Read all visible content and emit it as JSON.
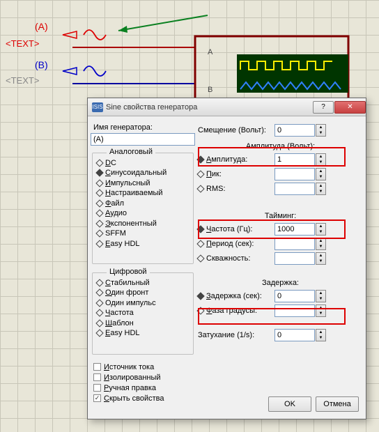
{
  "circuit": {
    "label_a": "(A)",
    "text_a": "<TEXT>",
    "label_b": "(B)",
    "text_b": "<TEXT>",
    "osc_a": "A",
    "osc_b": "B"
  },
  "dialog": {
    "title": "Sine свойства генератора",
    "name_label": "Имя генератора:",
    "name_value": "(A)",
    "analog_legend": "Аналоговый",
    "analog_items": [
      {
        "label": "DC",
        "u": "D"
      },
      {
        "label": "Синусоидальный",
        "u": "С",
        "selected": true
      },
      {
        "label": "Импульсный",
        "u": "И"
      },
      {
        "label": "Настраиваемый",
        "u": "Н"
      },
      {
        "label": "Файл",
        "u": "Ф"
      },
      {
        "label": "Аудио",
        "u": "А"
      },
      {
        "label": "Экспонентный",
        "u": "Э"
      },
      {
        "label": "SFFM"
      },
      {
        "label": "Easy HDL",
        "u": "E"
      }
    ],
    "digital_legend": "Цифровой",
    "digital_items": [
      {
        "label": "Стабильный",
        "u": "С"
      },
      {
        "label": "Один фронт",
        "u": "О"
      },
      {
        "label": "Один импульс"
      },
      {
        "label": "Частота",
        "u": "Ч"
      },
      {
        "label": "Шаблон",
        "u": "Ш"
      },
      {
        "label": "Easy HDL",
        "u": "E"
      }
    ],
    "checks": [
      {
        "label": "Источник тока",
        "u": "И"
      },
      {
        "label": "Изолированный",
        "u": "И"
      },
      {
        "label": "Ручная правка",
        "u": "Р"
      },
      {
        "label": "Скрыть свойства",
        "u": "С",
        "checked": true
      }
    ],
    "offset_label": "Смещение (Вольт):",
    "offset_value": "0",
    "amp_section": "Амплитуда (Вольт):",
    "amp_rows": [
      {
        "label": "Амплитуда:",
        "value": "1",
        "selected": true,
        "u": "А"
      },
      {
        "label": "Пик:",
        "u": "П"
      },
      {
        "label": "RMS:"
      }
    ],
    "time_section": "Тайминг:",
    "time_rows": [
      {
        "label": "Частота (Гц):",
        "value": "1000",
        "selected": true,
        "u": "Ч"
      },
      {
        "label": "Период (сек):",
        "u": "П"
      },
      {
        "label": "Скважность:"
      }
    ],
    "delay_section": "Задержка:",
    "delay_rows": [
      {
        "label": "Задержка (сек):",
        "value": "0",
        "selected": true,
        "u": "З"
      },
      {
        "label": "Фаза  градусы:",
        "u": "Ф"
      }
    ],
    "damping_label": "Затухание (1/s):",
    "damping_value": "0",
    "ok": "OK",
    "cancel": "Отмена"
  }
}
